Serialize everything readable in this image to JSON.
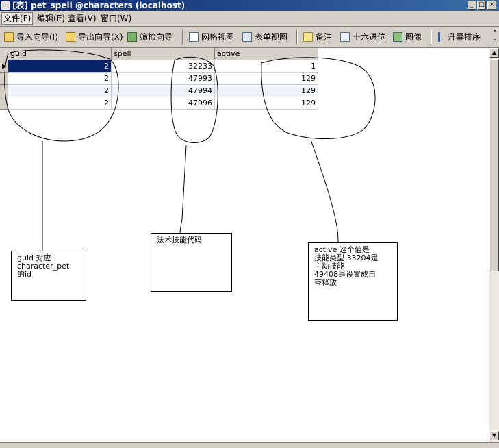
{
  "window": {
    "title": "[表] pet_spell @characters (localhost)"
  },
  "menu": [
    "文件(F)",
    "编辑(E)",
    "查看(V)",
    "窗口(W)"
  ],
  "toolbar": {
    "import": "导入向导(I)",
    "export": "导出向导(X)",
    "filter": "筛检向导",
    "grid_view": "网格视图",
    "form_view": "表单视图",
    "memo": "备注",
    "hex": "十六进位",
    "image": "图像",
    "sort_asc": "升幂排序"
  },
  "table": {
    "columns": [
      "guid",
      "spell",
      "active"
    ],
    "rows": [
      [
        "2",
        "32233",
        "1"
      ],
      [
        "2",
        "47993",
        "129"
      ],
      [
        "2",
        "47994",
        "129"
      ],
      [
        "2",
        "47996",
        "129"
      ]
    ]
  },
  "annotations": {
    "guid_note": "guid 对应\ncharacter_pet\n的id",
    "spell_note": "法术技能代码",
    "active_note": "active 这个值是\n技能类型 33204是\n主动技能\n49408是设置成自\n带释放"
  },
  "colors": {
    "title_start": "#0a246a",
    "selection": "#0a246a",
    "chrome": "#d4d0c8"
  }
}
